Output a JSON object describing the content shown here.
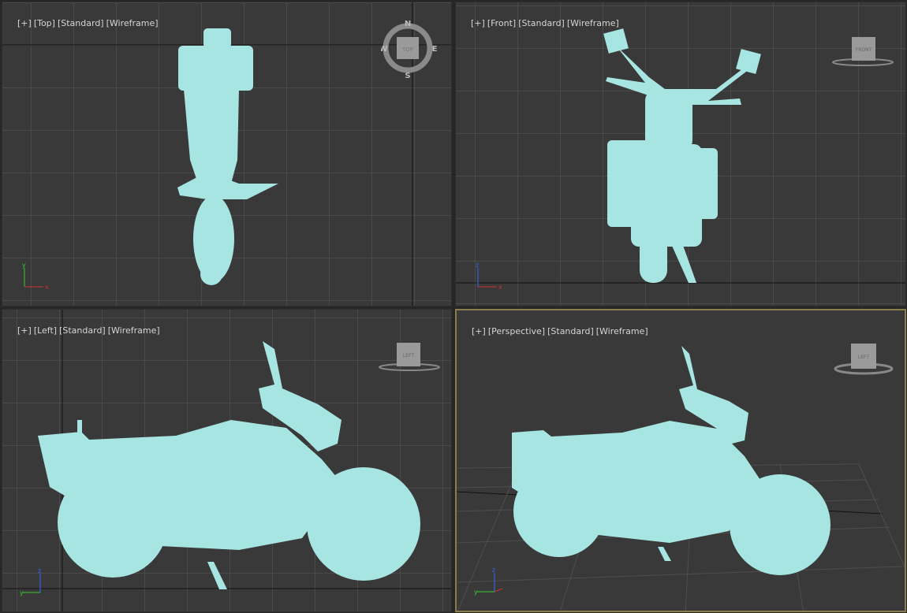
{
  "viewports": [
    {
      "menu": "[+]",
      "view": "[Top]",
      "shading": "[Standard]",
      "mode": "[Wireframe]",
      "viewcube": "TOP",
      "compass": {
        "n": "N",
        "s": "S",
        "e": "E",
        "w": "W"
      }
    },
    {
      "menu": "[+]",
      "view": "[Front]",
      "shading": "[Standard]",
      "mode": "[Wireframe]",
      "viewcube": "FRONT"
    },
    {
      "menu": "[+]",
      "view": "[Left]",
      "shading": "[Standard]",
      "mode": "[Wireframe]",
      "viewcube": "LEFT"
    },
    {
      "menu": "[+]",
      "view": "[Perspective]",
      "shading": "[Standard]",
      "mode": "[Wireframe]",
      "viewcube": "LEFT",
      "active": true
    }
  ],
  "colors": {
    "object": "#a7e5e2",
    "active_border": "#8c7d4e",
    "viewport_bg": "#393939"
  },
  "axes": {
    "x": "x",
    "y": "y",
    "z": "z"
  }
}
